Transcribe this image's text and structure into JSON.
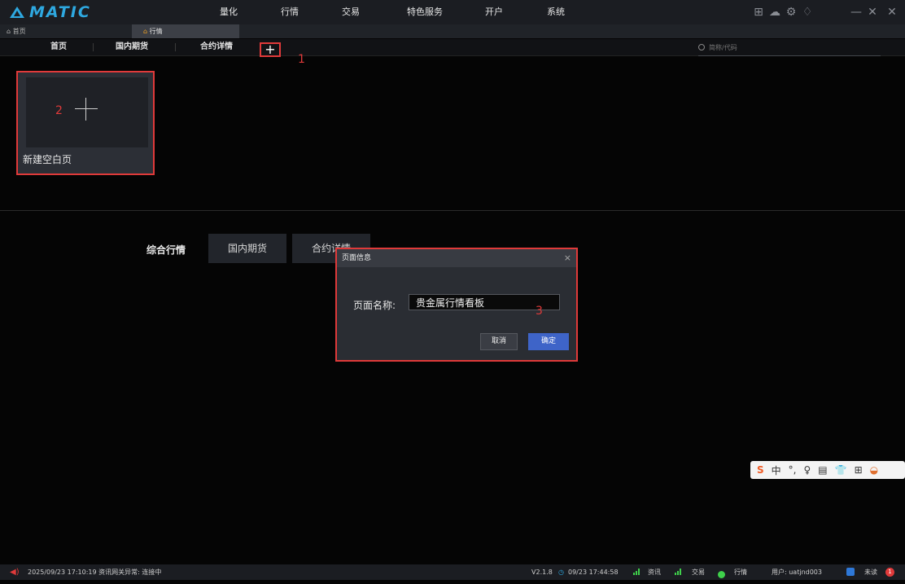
{
  "app": {
    "logo": "MATIC"
  },
  "menu": {
    "items": [
      "量化",
      "行情",
      "交易",
      "特色服务",
      "开户",
      "系统"
    ]
  },
  "page_tabs": {
    "home": "首页",
    "market": "行情"
  },
  "sub_nav": {
    "items": [
      "首页",
      "国内期货",
      "合约详情"
    ],
    "add_label": "+"
  },
  "search": {
    "placeholder": "简称/代码"
  },
  "annotations": {
    "one": "1",
    "two": "2",
    "three": "3"
  },
  "new_page_card": {
    "label": "新建空白页"
  },
  "quick_templates": {
    "title": "综合行情",
    "buttons": [
      "国内期货",
      "合约详情"
    ]
  },
  "dialog": {
    "title": "页面信息",
    "close": "×",
    "field_label": "页面名称:",
    "field_value": "贵金属行情看板",
    "cancel_label": "取消",
    "ok_label": "确定"
  },
  "ime_toolbar": {
    "items": [
      "S",
      "中",
      "°,",
      "♀",
      "▤",
      "👕",
      "⊞",
      "◒"
    ]
  },
  "status_bar": {
    "log": "2025/09/23 17:10:19 资讯网关异常: 连接中",
    "version": "V2.1.8",
    "time": "09/23 17:44:58",
    "info_label": "资讯",
    "trade_label": "交易",
    "market_label": "行情",
    "user": "用户: uatjnd003",
    "unread_label": "未读",
    "unread_count": "1"
  },
  "colors": {
    "accent": "#2ea8e0",
    "highlight_box": "#e03a3a",
    "primary_button": "#3e64c8",
    "signal": "#3fd04b"
  }
}
